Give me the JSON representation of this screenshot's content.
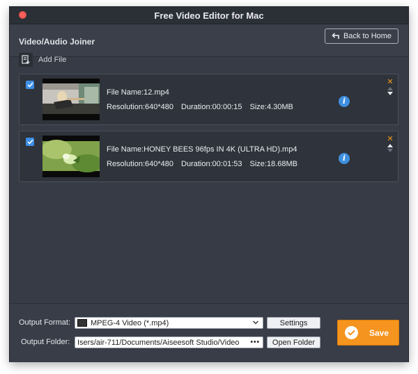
{
  "window": {
    "title": "Free Video Editor for Mac"
  },
  "header": {
    "section_title": "Video/Audio Joiner",
    "back_button_label": "Back to Home"
  },
  "toolbar": {
    "add_file_label": "Add File",
    "add_file_icon": "add-file-icon"
  },
  "files": [
    {
      "checked": true,
      "name": "File Name:12.mp4",
      "resolution": "Resolution:640*480",
      "duration": "Duration:00:00:15",
      "size": "Size:4.30MB"
    },
    {
      "checked": true,
      "name": "File Name:HONEY BEES 96fps IN 4K (ULTRA HD).mp4",
      "resolution": "Resolution:640*480",
      "duration": "Duration:00:01:53",
      "size": "Size:18.68MB"
    }
  ],
  "output": {
    "format_label": "Output Format:",
    "format_value": "MPEG-4 Video (*.mp4)",
    "settings_label": "Settings",
    "folder_label": "Output Folder:",
    "folder_value": "Isers/air-711/Documents/Aiseesoft Studio/Video",
    "more_label": "•••",
    "open_folder_label": "Open Folder",
    "save_label": "Save"
  },
  "colors": {
    "accent_orange": "#f5941e",
    "info_blue": "#3e8fdf",
    "check_blue": "#3d8fe6",
    "background": "#363b45"
  }
}
